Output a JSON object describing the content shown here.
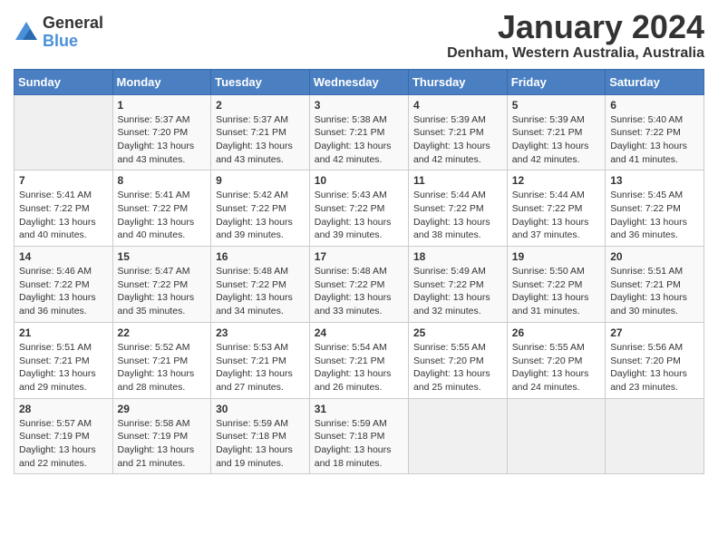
{
  "header": {
    "logo_general": "General",
    "logo_blue": "Blue",
    "month_year": "January 2024",
    "location": "Denham, Western Australia, Australia"
  },
  "columns": [
    "Sunday",
    "Monday",
    "Tuesday",
    "Wednesday",
    "Thursday",
    "Friday",
    "Saturday"
  ],
  "weeks": [
    [
      {
        "day": "",
        "sunrise": "",
        "sunset": "",
        "daylight": ""
      },
      {
        "day": "1",
        "sunrise": "Sunrise: 5:37 AM",
        "sunset": "Sunset: 7:20 PM",
        "daylight": "Daylight: 13 hours and 43 minutes."
      },
      {
        "day": "2",
        "sunrise": "Sunrise: 5:37 AM",
        "sunset": "Sunset: 7:21 PM",
        "daylight": "Daylight: 13 hours and 43 minutes."
      },
      {
        "day": "3",
        "sunrise": "Sunrise: 5:38 AM",
        "sunset": "Sunset: 7:21 PM",
        "daylight": "Daylight: 13 hours and 42 minutes."
      },
      {
        "day": "4",
        "sunrise": "Sunrise: 5:39 AM",
        "sunset": "Sunset: 7:21 PM",
        "daylight": "Daylight: 13 hours and 42 minutes."
      },
      {
        "day": "5",
        "sunrise": "Sunrise: 5:39 AM",
        "sunset": "Sunset: 7:21 PM",
        "daylight": "Daylight: 13 hours and 42 minutes."
      },
      {
        "day": "6",
        "sunrise": "Sunrise: 5:40 AM",
        "sunset": "Sunset: 7:22 PM",
        "daylight": "Daylight: 13 hours and 41 minutes."
      }
    ],
    [
      {
        "day": "7",
        "sunrise": "Sunrise: 5:41 AM",
        "sunset": "Sunset: 7:22 PM",
        "daylight": "Daylight: 13 hours and 40 minutes."
      },
      {
        "day": "8",
        "sunrise": "Sunrise: 5:41 AM",
        "sunset": "Sunset: 7:22 PM",
        "daylight": "Daylight: 13 hours and 40 minutes."
      },
      {
        "day": "9",
        "sunrise": "Sunrise: 5:42 AM",
        "sunset": "Sunset: 7:22 PM",
        "daylight": "Daylight: 13 hours and 39 minutes."
      },
      {
        "day": "10",
        "sunrise": "Sunrise: 5:43 AM",
        "sunset": "Sunset: 7:22 PM",
        "daylight": "Daylight: 13 hours and 39 minutes."
      },
      {
        "day": "11",
        "sunrise": "Sunrise: 5:44 AM",
        "sunset": "Sunset: 7:22 PM",
        "daylight": "Daylight: 13 hours and 38 minutes."
      },
      {
        "day": "12",
        "sunrise": "Sunrise: 5:44 AM",
        "sunset": "Sunset: 7:22 PM",
        "daylight": "Daylight: 13 hours and 37 minutes."
      },
      {
        "day": "13",
        "sunrise": "Sunrise: 5:45 AM",
        "sunset": "Sunset: 7:22 PM",
        "daylight": "Daylight: 13 hours and 36 minutes."
      }
    ],
    [
      {
        "day": "14",
        "sunrise": "Sunrise: 5:46 AM",
        "sunset": "Sunset: 7:22 PM",
        "daylight": "Daylight: 13 hours and 36 minutes."
      },
      {
        "day": "15",
        "sunrise": "Sunrise: 5:47 AM",
        "sunset": "Sunset: 7:22 PM",
        "daylight": "Daylight: 13 hours and 35 minutes."
      },
      {
        "day": "16",
        "sunrise": "Sunrise: 5:48 AM",
        "sunset": "Sunset: 7:22 PM",
        "daylight": "Daylight: 13 hours and 34 minutes."
      },
      {
        "day": "17",
        "sunrise": "Sunrise: 5:48 AM",
        "sunset": "Sunset: 7:22 PM",
        "daylight": "Daylight: 13 hours and 33 minutes."
      },
      {
        "day": "18",
        "sunrise": "Sunrise: 5:49 AM",
        "sunset": "Sunset: 7:22 PM",
        "daylight": "Daylight: 13 hours and 32 minutes."
      },
      {
        "day": "19",
        "sunrise": "Sunrise: 5:50 AM",
        "sunset": "Sunset: 7:22 PM",
        "daylight": "Daylight: 13 hours and 31 minutes."
      },
      {
        "day": "20",
        "sunrise": "Sunrise: 5:51 AM",
        "sunset": "Sunset: 7:21 PM",
        "daylight": "Daylight: 13 hours and 30 minutes."
      }
    ],
    [
      {
        "day": "21",
        "sunrise": "Sunrise: 5:51 AM",
        "sunset": "Sunset: 7:21 PM",
        "daylight": "Daylight: 13 hours and 29 minutes."
      },
      {
        "day": "22",
        "sunrise": "Sunrise: 5:52 AM",
        "sunset": "Sunset: 7:21 PM",
        "daylight": "Daylight: 13 hours and 28 minutes."
      },
      {
        "day": "23",
        "sunrise": "Sunrise: 5:53 AM",
        "sunset": "Sunset: 7:21 PM",
        "daylight": "Daylight: 13 hours and 27 minutes."
      },
      {
        "day": "24",
        "sunrise": "Sunrise: 5:54 AM",
        "sunset": "Sunset: 7:21 PM",
        "daylight": "Daylight: 13 hours and 26 minutes."
      },
      {
        "day": "25",
        "sunrise": "Sunrise: 5:55 AM",
        "sunset": "Sunset: 7:20 PM",
        "daylight": "Daylight: 13 hours and 25 minutes."
      },
      {
        "day": "26",
        "sunrise": "Sunrise: 5:55 AM",
        "sunset": "Sunset: 7:20 PM",
        "daylight": "Daylight: 13 hours and 24 minutes."
      },
      {
        "day": "27",
        "sunrise": "Sunrise: 5:56 AM",
        "sunset": "Sunset: 7:20 PM",
        "daylight": "Daylight: 13 hours and 23 minutes."
      }
    ],
    [
      {
        "day": "28",
        "sunrise": "Sunrise: 5:57 AM",
        "sunset": "Sunset: 7:19 PM",
        "daylight": "Daylight: 13 hours and 22 minutes."
      },
      {
        "day": "29",
        "sunrise": "Sunrise: 5:58 AM",
        "sunset": "Sunset: 7:19 PM",
        "daylight": "Daylight: 13 hours and 21 minutes."
      },
      {
        "day": "30",
        "sunrise": "Sunrise: 5:59 AM",
        "sunset": "Sunset: 7:18 PM",
        "daylight": "Daylight: 13 hours and 19 minutes."
      },
      {
        "day": "31",
        "sunrise": "Sunrise: 5:59 AM",
        "sunset": "Sunset: 7:18 PM",
        "daylight": "Daylight: 13 hours and 18 minutes."
      },
      {
        "day": "",
        "sunrise": "",
        "sunset": "",
        "daylight": ""
      },
      {
        "day": "",
        "sunrise": "",
        "sunset": "",
        "daylight": ""
      },
      {
        "day": "",
        "sunrise": "",
        "sunset": "",
        "daylight": ""
      }
    ]
  ]
}
